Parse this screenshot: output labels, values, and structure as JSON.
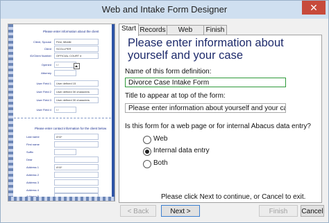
{
  "window": {
    "title": "Web and Intake Form Designer",
    "close_glyph": "✕"
  },
  "preview": {
    "heading1": "Please enter information about the client",
    "rows1": [
      {
        "label": "Client, Spouse",
        "value": "First, Middle"
      },
      {
        "label": "Client",
        "value": "SCGLLPER"
      },
      {
        "label": "ID/Client Number",
        "value": "OFFICIAL COURT #"
      },
      {
        "label": "Opened",
        "value": "/ /"
      },
      {
        "label": "Attorney",
        "value": ""
      },
      {
        "label": "User Field 1",
        "value": "User defined 15"
      },
      {
        "label": "User Field 2",
        "value": "User defined 30 characters"
      },
      {
        "label": "User Field 3",
        "value": "User defined 30 characters"
      },
      {
        "label": "User Field 4",
        "value": "/ /"
      }
    ],
    "heading2": "Please enter contact information for the client below",
    "rows2": [
      {
        "label": "Last name",
        "value": "A*&*"
      },
      {
        "label": "First name",
        "value": ""
      },
      {
        "label": "Suffix",
        "value": ""
      },
      {
        "label": "Dear",
        "value": ""
      },
      {
        "label": "Address 1",
        "value": "A*&*"
      },
      {
        "label": "Address 2",
        "value": ""
      },
      {
        "label": "Address 3",
        "value": ""
      },
      {
        "label": "Address 4",
        "value": ""
      },
      {
        "label": "Address 5",
        "value": ""
      }
    ]
  },
  "tabs": [
    "Start",
    "Records",
    "Web Details",
    "Finish"
  ],
  "panel": {
    "heading": "Please enter information about yourself and your case",
    "form_name_label": "Name of this form definition:",
    "form_name_value": "Divorce Case Intake Form",
    "title_label": "Title to appear at top of the form:",
    "title_value": "Please enter information about yourself and your case",
    "question": "Is this form for a web page or for internal Abacus data entry?",
    "options": [
      {
        "label": "Web",
        "checked": false
      },
      {
        "label": "Internal data entry",
        "checked": true
      },
      {
        "label": "Both",
        "checked": false
      }
    ],
    "footer": "Please click Next to continue, or Cancel to exit."
  },
  "buttons": {
    "back": "< Back",
    "next": "Next >",
    "finish": "Finish",
    "cancel": "Cancel"
  }
}
